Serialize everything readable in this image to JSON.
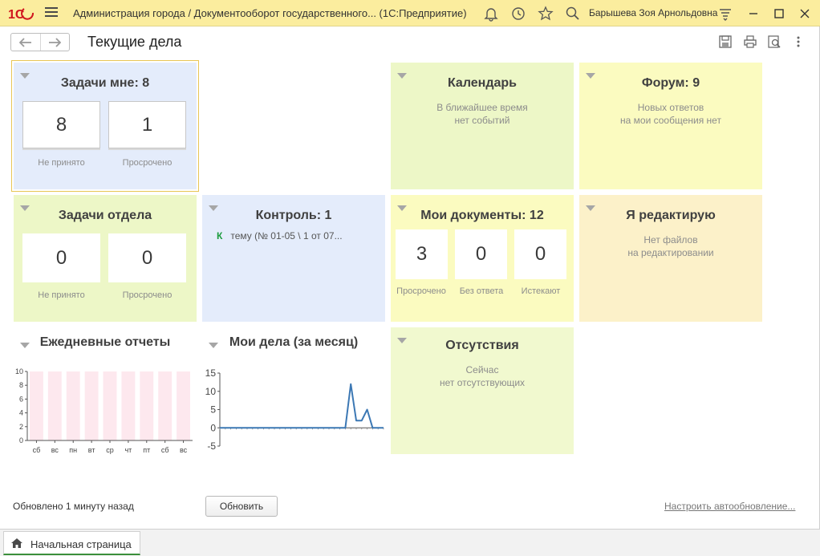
{
  "app": {
    "title": "Администрация города / Документооборот государственного...  (1С:Предприятие)",
    "user": "Барышева Зоя Арнольдовна"
  },
  "icons": {
    "logo": "1c-logo-icon",
    "menu": "hamburger-icon",
    "bell": "bell-icon",
    "history": "history-icon",
    "favorite": "star-icon",
    "search": "search-icon",
    "settings": "settings-icon",
    "minimize": "minimize-icon",
    "maximize": "maximize-icon",
    "close": "close-icon",
    "back": "arrow-left-icon",
    "forward": "arrow-right-icon",
    "save": "save-icon",
    "print": "print-icon",
    "preview": "preview-icon",
    "more": "more-vertical-icon",
    "home": "home-icon"
  },
  "colors": {
    "titlebar": "#fbed9e",
    "blue_tile": "#e4ecfb",
    "green_tile": "#edf7c7",
    "yellow_tile": "#fbfbc0",
    "orange_tile": "#fcf1c9",
    "chart_line": "#3c78b4",
    "bar_fill": "#fde8ee",
    "control_marker": "#1a9b3c"
  },
  "page": {
    "title": "Текущие дела"
  },
  "tiles": {
    "my_tasks": {
      "title": "Задачи мне: 8",
      "counters": [
        {
          "value": "8",
          "label": "Не принято"
        },
        {
          "value": "1",
          "label": "Просрочено"
        }
      ]
    },
    "calendar": {
      "title": "Календарь",
      "subtitle_line1": "В ближайшее время",
      "subtitle_line2": "нет событий"
    },
    "forum": {
      "title": "Форум: 9",
      "subtitle_line1": "Новых ответов",
      "subtitle_line2": "на мои сообщения нет"
    },
    "dept_tasks": {
      "title": "Задачи отдела",
      "counters": [
        {
          "value": "0",
          "label": "Не принято"
        },
        {
          "value": "0",
          "label": "Просрочено"
        }
      ]
    },
    "control": {
      "title": "Контроль: 1",
      "marker": "К",
      "item": "тему (№ 01-05 \\ 1 от 07..."
    },
    "my_docs": {
      "title": "Мои документы: 12",
      "counters": [
        {
          "value": "3",
          "label": "Просрочено"
        },
        {
          "value": "0",
          "label": "Без ответа"
        },
        {
          "value": "0",
          "label": "Истекают"
        }
      ]
    },
    "editing": {
      "title": "Я редактирую",
      "subtitle_line1": "Нет файлов",
      "subtitle_line2": "на редактировании"
    },
    "daily_reports": {
      "title": "Ежедневные отчеты"
    },
    "my_affairs": {
      "title": "Мои дела (за месяц)"
    },
    "absences": {
      "title": "Отсутствия",
      "subtitle_line1": "Сейчас",
      "subtitle_line2": "нет отсутствующих"
    }
  },
  "chart_data": [
    {
      "type": "bar",
      "categories": [
        "сб",
        "вс",
        "пн",
        "вт",
        "ср",
        "чт",
        "пт",
        "сб",
        "вс"
      ],
      "values": [
        10,
        10,
        10,
        10,
        10,
        10,
        10,
        10,
        10
      ],
      "title": "Ежедневные отчеты",
      "xlabel": "",
      "ylabel": "",
      "ylim": [
        0,
        10
      ],
      "yticks": [
        "0",
        "2",
        "4",
        "6",
        "8",
        "10"
      ]
    },
    {
      "type": "line",
      "x": [
        0,
        1,
        2,
        3,
        4,
        5,
        6,
        7,
        8,
        9,
        10,
        11,
        12,
        13,
        14,
        15,
        16,
        17,
        18,
        19,
        20,
        21,
        22,
        23,
        24,
        25,
        26,
        27,
        28,
        29,
        30
      ],
      "values": [
        0,
        0,
        0,
        0,
        0,
        0,
        0,
        0,
        0,
        0,
        0,
        0,
        0,
        0,
        0,
        0,
        0,
        0,
        0,
        0,
        0,
        0,
        0,
        0,
        12,
        2,
        2,
        5,
        0,
        0,
        0
      ],
      "title": "Мои дела (за месяц)",
      "xlabel": "",
      "ylabel": "",
      "ylim": [
        -5,
        15
      ],
      "yticks": [
        "-5",
        "0",
        "5",
        "10",
        "15"
      ]
    }
  ],
  "footer": {
    "status": "Обновлено 1 минуту назад",
    "refresh_label": "Обновить",
    "autorefresh_label": "Настроить автообновление..."
  },
  "tabs": {
    "home_label": "Начальная страница"
  }
}
